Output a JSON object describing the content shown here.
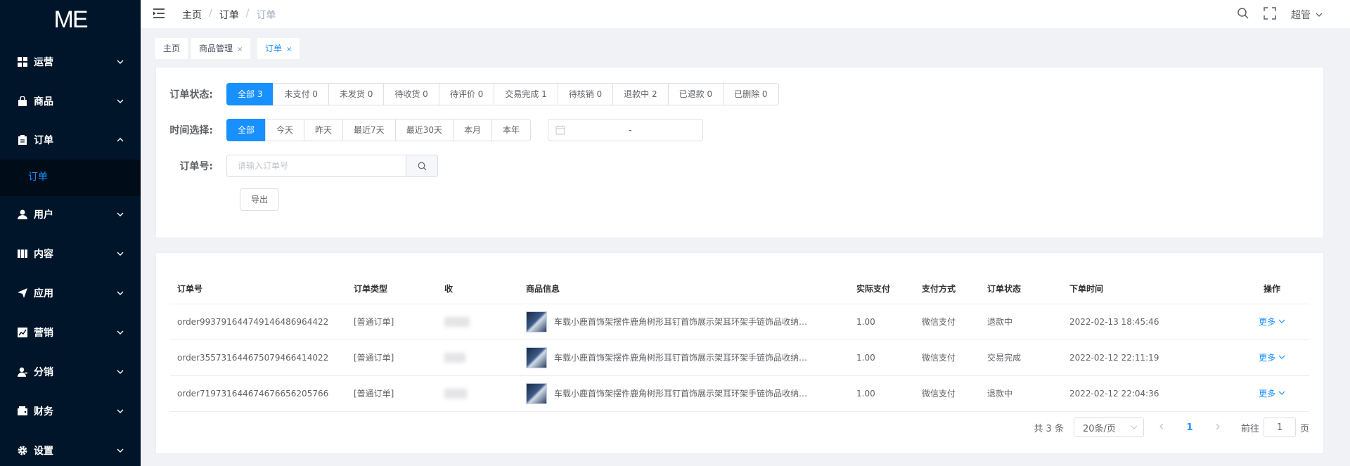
{
  "app": {
    "logo": "ME"
  },
  "sidebar": {
    "items": [
      {
        "label": "运营",
        "icon": "grid-icon",
        "expanded": false
      },
      {
        "label": "商品",
        "icon": "shopping-bag-icon",
        "expanded": false
      },
      {
        "label": "订单",
        "icon": "clipboard-icon",
        "expanded": true
      },
      {
        "label": "用户",
        "icon": "user-icon",
        "expanded": false
      },
      {
        "label": "内容",
        "icon": "book-icon",
        "expanded": false
      },
      {
        "label": "应用",
        "icon": "send-icon",
        "expanded": false
      },
      {
        "label": "营销",
        "icon": "chart-icon",
        "expanded": false
      },
      {
        "label": "分销",
        "icon": "user-share-icon",
        "expanded": false
      },
      {
        "label": "财务",
        "icon": "wallet-icon",
        "expanded": false
      },
      {
        "label": "设置",
        "icon": "gear-icon",
        "expanded": false
      }
    ],
    "submenu": {
      "label": "订单"
    }
  },
  "header": {
    "breadcrumb": [
      "主页",
      "订单",
      "订单"
    ],
    "user": "超管"
  },
  "tags": [
    {
      "label": "主页",
      "closable": false,
      "active": false
    },
    {
      "label": "商品管理",
      "closable": true,
      "active": false
    },
    {
      "label": "订单",
      "closable": true,
      "active": true
    }
  ],
  "filters": {
    "status_label": "订单状态:",
    "status_options": [
      "全部 3",
      "未支付 0",
      "未发货 0",
      "待收货 0",
      "待评价 0",
      "交易完成 1",
      "待核销 0",
      "退款中 2",
      "已退款 0",
      "已删除 0"
    ],
    "status_selected": "全部 3",
    "time_label": "时间选择:",
    "time_options": [
      "全部",
      "今天",
      "昨天",
      "最近7天",
      "最近30天",
      "本月",
      "本年"
    ],
    "time_selected": "全部",
    "date_range_separator": "-",
    "order_no_label": "订单号:",
    "order_no_placeholder": "请输入订单号",
    "order_no_value": "",
    "export_label": "导出"
  },
  "table": {
    "columns": [
      "订单号",
      "订单类型",
      "收",
      "商品信息",
      "实际支付",
      "支付方式",
      "订单状态",
      "下单时间",
      "操作"
    ],
    "rows": [
      {
        "order_no": "order993791644749146486964422",
        "type": "[普通订单]",
        "goods": "车载小鹿首饰架摆件鹿角树形耳钉首饰展示架耳环架手链饰品收纳…",
        "paid": "1.00",
        "pay_method": "微信支付",
        "status": "退款中",
        "time": "2022-02-13 18:45:46",
        "action": "更多"
      },
      {
        "order_no": "order355731644675079466414022",
        "type": "[普通订单]",
        "goods": "车载小鹿首饰架摆件鹿角树形耳钉首饰展示架耳环架手链饰品收纳…",
        "paid": "1.00",
        "pay_method": "微信支付",
        "status": "交易完成",
        "time": "2022-02-12 22:11:19",
        "action": "更多"
      },
      {
        "order_no": "order719731644674676656205766",
        "type": "[普通订单]",
        "goods": "车载小鹿首饰架摆件鹿角树形耳钉首饰展示架耳环架手链饰品收纳…",
        "paid": "1.00",
        "pay_method": "微信支付",
        "status": "退款中",
        "time": "2022-02-12 22:04:36",
        "action": "更多"
      }
    ]
  },
  "pagination": {
    "total": "共 3 条",
    "page_size": "20条/页",
    "current_page": "1",
    "goto_prefix": "前往",
    "goto_value": "1",
    "goto_suffix": "页"
  },
  "colors": {
    "sidebar": "#001529",
    "accent": "#1890ff"
  }
}
